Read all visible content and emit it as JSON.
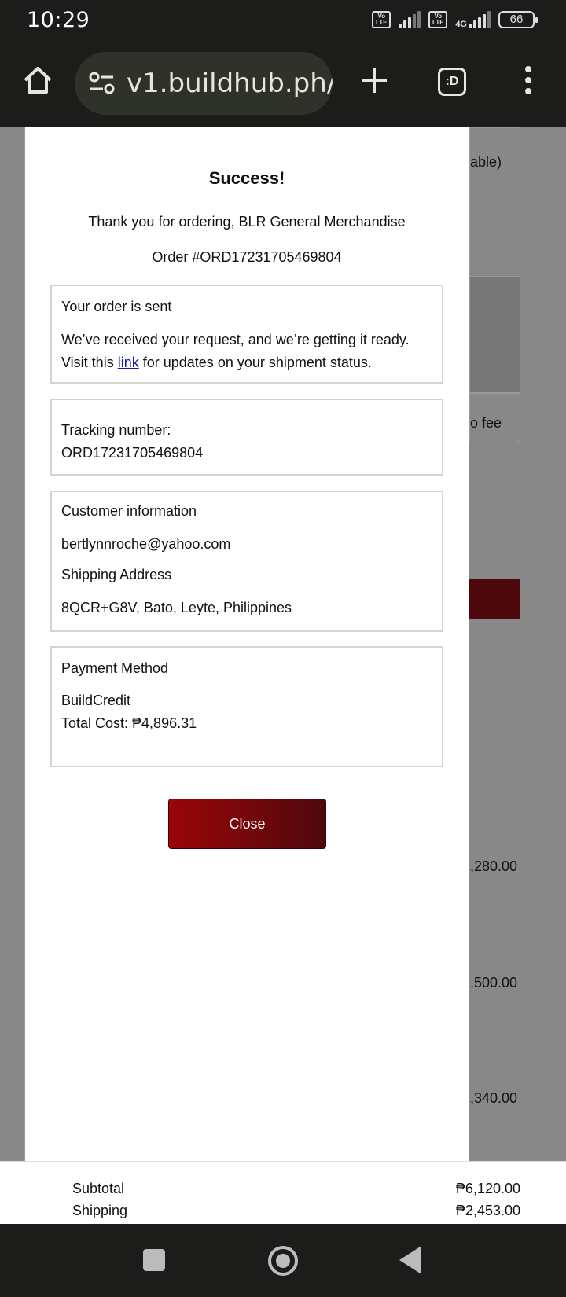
{
  "status_bar": {
    "time": "10:29",
    "network": "4G",
    "volte": "Vo LTE",
    "battery": "66"
  },
  "browser": {
    "url": "v1.buildhub.ph/",
    "tabs_label": ":D",
    "icons": [
      "home-icon",
      "tune-icon",
      "plus-icon",
      "tabs-icon",
      "more-vert-icon"
    ]
  },
  "background": {
    "card_text_1": "able)",
    "card_text_2": "o fee",
    "amounts": [
      ",280.00",
      ".500.00",
      ",340.00"
    ],
    "summary": {
      "subtotal_label": "Subtotal",
      "subtotal_value": "₱6,120.00",
      "shipping_label": "Shipping",
      "shipping_value": "₱2,453.00"
    }
  },
  "modal": {
    "title": "Success!",
    "thanks": "Thank you for ordering, BLR General Merchandise",
    "order_number": "Order #ORD17231705469804",
    "sent_box": {
      "heading": "Your order is sent",
      "line1": "We’ve received your request, and we’re getting it ready.",
      "line2_prefix": "Visit this",
      "link_text": "link",
      "line2_suffix": "for updates on your shipment status."
    },
    "tracking_box": {
      "label": "Tracking number:",
      "value": "ORD17231705469804"
    },
    "customer_box": {
      "heading": "Customer information",
      "email": "bertlynnroche@yahoo.com",
      "address_heading": "Shipping Address",
      "address": "8QCR+G8V, Bato, Leyte, Philippines"
    },
    "payment_box": {
      "heading": "Payment Method",
      "method": "BuildCredit",
      "total": "Total Cost: ₱4,896.31"
    },
    "close_label": "Close"
  },
  "colors": {
    "accent_dark_red": "#4f080d",
    "accent_red": "#9a0508",
    "system_bar": "#1c1d1a",
    "overlay": "#888888"
  }
}
